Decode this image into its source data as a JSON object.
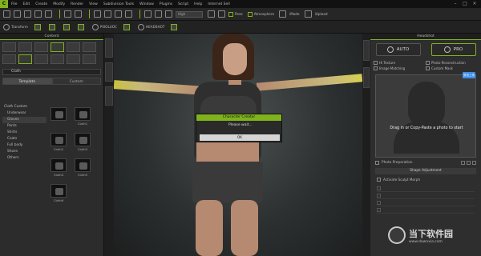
{
  "menu": [
    "File",
    "Edit",
    "Create",
    "Modify",
    "Render",
    "View",
    "Subdivision Tools",
    "Window",
    "Plugins",
    "Script",
    "Help",
    "Internet Sell"
  ],
  "toolbar1": {
    "quality": "High",
    "pose_label": "Pose",
    "atmosphere_label": "Atmosphere",
    "mode1": "iMode",
    "mode2": "iUpload"
  },
  "toolbar2": {
    "transform": "Transform",
    "pixie": "PIXOLUOC",
    "headshot": "HEADSHOT"
  },
  "content": {
    "title": "Content",
    "path": "Cloth",
    "tabs": [
      "Template",
      "Custom"
    ],
    "tree": [
      "Cloth Custom",
      "Underwear",
      "Gloves",
      "Pants",
      "Shirts",
      "Coats",
      "Full body",
      "Shoes",
      "Others"
    ],
    "thumbs": [
      "",
      "Cloth1",
      "Cloth2",
      "Cloth3",
      "Cloth4",
      "Cloth5",
      "Cloth6"
    ]
  },
  "dialog": {
    "title": "Character Creator",
    "message": "Please wait...",
    "ok": "OK"
  },
  "headshot": {
    "title": "Headshot",
    "auto": "AUTO",
    "pro": "PRO",
    "opts": [
      "Hi Texture",
      "Photo Reconstruction",
      "Image Matching",
      "Custom Mask"
    ],
    "drop_text": "Drag in or Copy-Paste a photo to start",
    "badge": "剪拍上传",
    "photo_row": "Photo Preparation",
    "shape_adjustment": "Shape Adjustment",
    "advanced": "Activate Sculpt Morph"
  },
  "watermark": {
    "big": "当下软件园",
    "small": "www.downxia.com"
  }
}
